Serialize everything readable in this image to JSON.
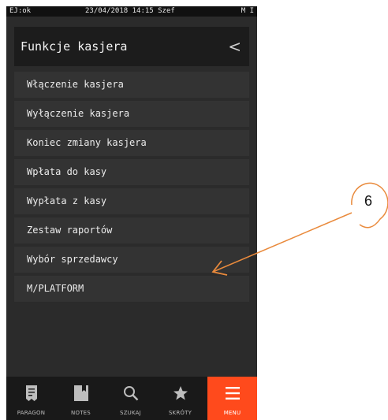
{
  "status": {
    "left": "EJ:ok",
    "center": "23/04/2018 14:15 Szef",
    "right": "M I"
  },
  "header": {
    "title": "Funkcje kasjera",
    "back_glyph": "<"
  },
  "menu": {
    "items": [
      {
        "label": "Włączenie kasjera"
      },
      {
        "label": "Wyłączenie kasjera"
      },
      {
        "label": "Koniec zmiany kasjera"
      },
      {
        "label": "Wpłata do kasy"
      },
      {
        "label": "Wypłata z kasy"
      },
      {
        "label": "Zestaw raportów"
      },
      {
        "label": "Wybór sprzedawcy"
      },
      {
        "label": "M/PLATFORM"
      }
    ]
  },
  "bottom_bar": {
    "tabs": [
      {
        "label": "PARAGON",
        "icon": "receipt-icon"
      },
      {
        "label": "NOTES",
        "icon": "notebook-icon"
      },
      {
        "label": "SZUKAJ",
        "icon": "search-icon"
      },
      {
        "label": "SKRÓTY",
        "icon": "star-icon"
      },
      {
        "label": "MENU",
        "icon": "hamburger-icon",
        "active": true
      }
    ],
    "active_color": "#ff4a1c"
  },
  "annotation": {
    "number": "6",
    "color": "#e98a3c"
  }
}
